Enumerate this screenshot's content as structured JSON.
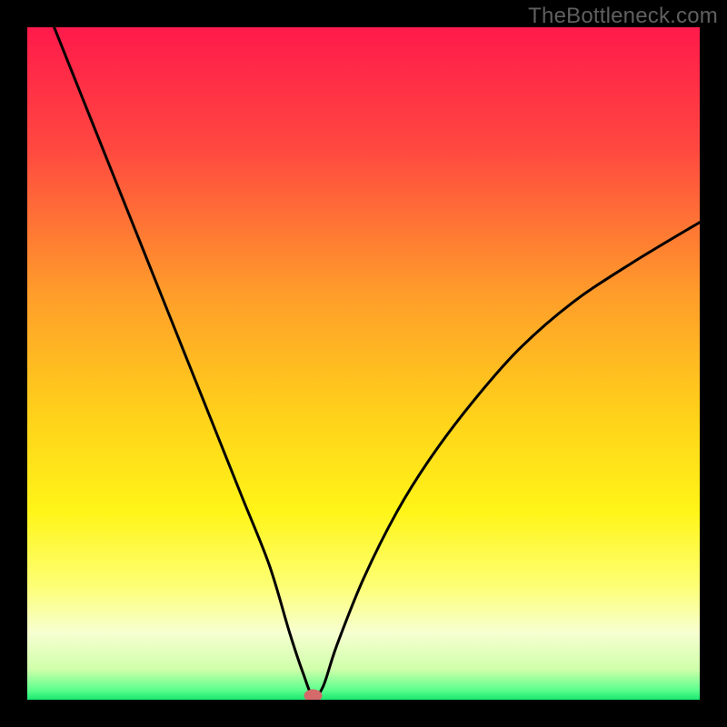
{
  "watermark": "TheBottleneck.com",
  "chart_data": {
    "type": "line",
    "title": "",
    "xlabel": "",
    "ylabel": "",
    "xlim": [
      0,
      100
    ],
    "ylim": [
      0,
      100
    ],
    "grid": false,
    "legend": false,
    "gradient_stops": [
      {
        "offset": 0.0,
        "color": "#ff1a4b"
      },
      {
        "offset": 0.18,
        "color": "#ff4840"
      },
      {
        "offset": 0.4,
        "color": "#ff9e2a"
      },
      {
        "offset": 0.58,
        "color": "#ffd21a"
      },
      {
        "offset": 0.72,
        "color": "#fff518"
      },
      {
        "offset": 0.83,
        "color": "#fdff74"
      },
      {
        "offset": 0.9,
        "color": "#f7ffd1"
      },
      {
        "offset": 0.955,
        "color": "#cfffaa"
      },
      {
        "offset": 0.985,
        "color": "#5fff8f"
      },
      {
        "offset": 1.0,
        "color": "#19e86f"
      }
    ],
    "series": [
      {
        "name": "bottleneck-curve",
        "x": [
          4,
          8,
          12,
          16,
          20,
          24,
          28,
          32,
          36,
          39,
          41,
          42.5,
          44,
          46,
          50,
          55,
          60,
          66,
          73,
          81,
          90,
          100
        ],
        "y": [
          100,
          90,
          80,
          70,
          60,
          50,
          40,
          30,
          20,
          10,
          4,
          0.5,
          2,
          8,
          18,
          28,
          36,
          44,
          52,
          59,
          65,
          71
        ]
      }
    ],
    "marker": {
      "x": 42.5,
      "y": 0.6,
      "color": "#d46a6a"
    }
  }
}
